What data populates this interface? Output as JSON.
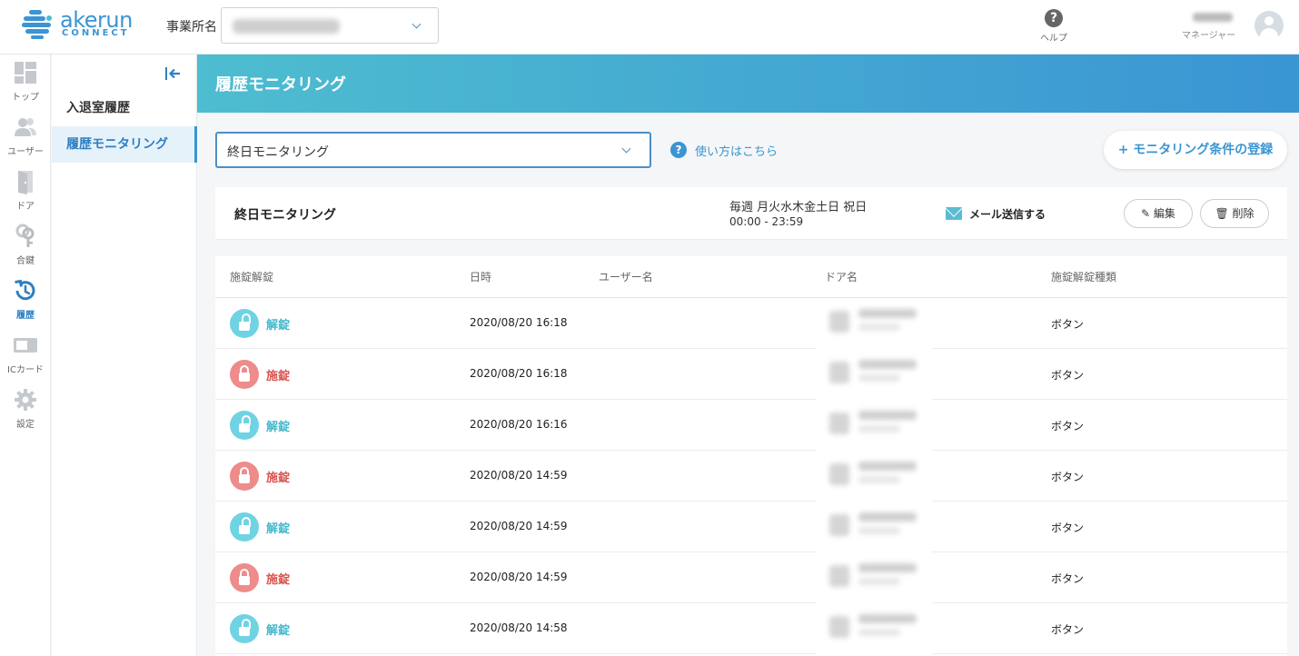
{
  "app": {
    "logo_text": "akerun",
    "logo_sub": "CONNECT"
  },
  "header": {
    "office_label": "事業所名",
    "help_label": "ヘルプ",
    "user_role": "マネージャー"
  },
  "rail": [
    {
      "label": "トップ",
      "icon": "dashboard-icon"
    },
    {
      "label": "ユーザー",
      "icon": "users-icon"
    },
    {
      "label": "ドア",
      "icon": "door-icon"
    },
    {
      "label": "合鍵",
      "icon": "key-icon"
    },
    {
      "label": "履歴",
      "icon": "history-icon",
      "active": true
    },
    {
      "label": "ICカード",
      "icon": "ic-card-icon"
    },
    {
      "label": "設定",
      "icon": "gear-icon"
    }
  ],
  "subnav": [
    {
      "label": "入退室履歴"
    },
    {
      "label": "履歴モニタリング",
      "active": true
    }
  ],
  "page": {
    "title": "履歴モニタリング",
    "condition_select_value": "終日モニタリング",
    "howto_label": "使い方はこちら",
    "add_button_label": "+ モニタリング条件の登録"
  },
  "condition": {
    "name": "終日モニタリング",
    "days": "毎週 月火水木金土日 祝日",
    "time": "00:00 - 23:59",
    "mail_label": "メール送信する",
    "edit_label": "✎ 編集",
    "delete_label": "🗑 削除"
  },
  "table": {
    "headers": {
      "lock": "施錠解錠",
      "datetime": "日時",
      "user": "ユーザー名",
      "door": "ドア名",
      "type": "施錠解錠種類"
    },
    "rows": [
      {
        "status": "解錠",
        "kind": "unlock",
        "datetime": "2020/08/20 16:18",
        "type": "ボタン"
      },
      {
        "status": "施錠",
        "kind": "lock",
        "datetime": "2020/08/20 16:18",
        "type": "ボタン"
      },
      {
        "status": "解錠",
        "kind": "unlock",
        "datetime": "2020/08/20 16:16",
        "type": "ボタン"
      },
      {
        "status": "施錠",
        "kind": "lock",
        "datetime": "2020/08/20 14:59",
        "type": "ボタン"
      },
      {
        "status": "解錠",
        "kind": "unlock",
        "datetime": "2020/08/20 14:59",
        "type": "ボタン"
      },
      {
        "status": "施錠",
        "kind": "lock",
        "datetime": "2020/08/20 14:59",
        "type": "ボタン"
      },
      {
        "status": "解錠",
        "kind": "unlock",
        "datetime": "2020/08/20 14:58",
        "type": "ボタン"
      }
    ]
  },
  "colors": {
    "accent": "#3a95d3",
    "unlock": "#6fd3e3",
    "lock": "#ee8b8b"
  }
}
